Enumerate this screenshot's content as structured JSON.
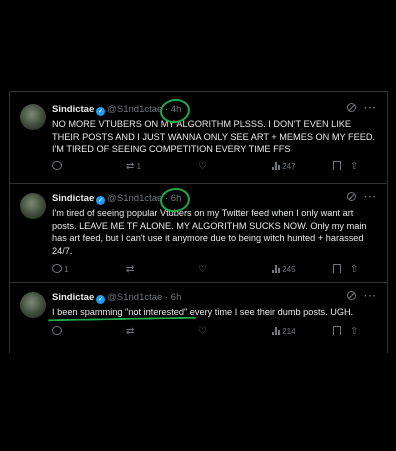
{
  "colors": {
    "background": "#000000",
    "divider": "#2f3336",
    "text": "#e7e9ea",
    "muted": "#71767b",
    "verified": "#1d9bf0",
    "annotation": "#1fa84a"
  },
  "icons": [
    "grok-icon",
    "more-icon",
    "reply-icon",
    "retweet-icon",
    "like-icon",
    "views-icon",
    "bookmark-icon",
    "share-icon",
    "verified-badge-icon"
  ],
  "tweets": [
    {
      "name": "Sindictae",
      "handle": "@S1nd1ctae",
      "sep": "·",
      "time": "4h",
      "more": "···",
      "text": "NO MORE VTUBERS ON MY ALGORITHM PLSSS. I DON'T EVEN LIKE THEIR POSTS AND I JUST WANNA ONLY SEE ART + MEMES ON MY FEED. I'M TIRED OF SEEING COMPETITION EVERY TIME FFS",
      "replies": "",
      "retweets": "1",
      "likes": "",
      "views": "247"
    },
    {
      "name": "Sindictae",
      "handle": "@S1nd1ctae",
      "sep": "·",
      "time": "6h",
      "more": "···",
      "text": "I'm tired of seeing popular Vtubers on my Twitter feed when I only want art posts. LEAVE ME TF ALONE. MY ALGORITHM SUCKS NOW. Only my main has art feed, but I can't use it anymore due to being witch hunted + harassed 24/7.",
      "replies": "1",
      "retweets": "",
      "likes": "",
      "views": "245"
    },
    {
      "name": "Sindictae",
      "handle": "@S1nd1ctae",
      "sep": "·",
      "time": "6h",
      "more": "···",
      "text": "I been spamming \"not interested\" every time I see their dumb posts. UGH.",
      "replies": "",
      "retweets": "",
      "likes": "",
      "views": "214"
    }
  ]
}
